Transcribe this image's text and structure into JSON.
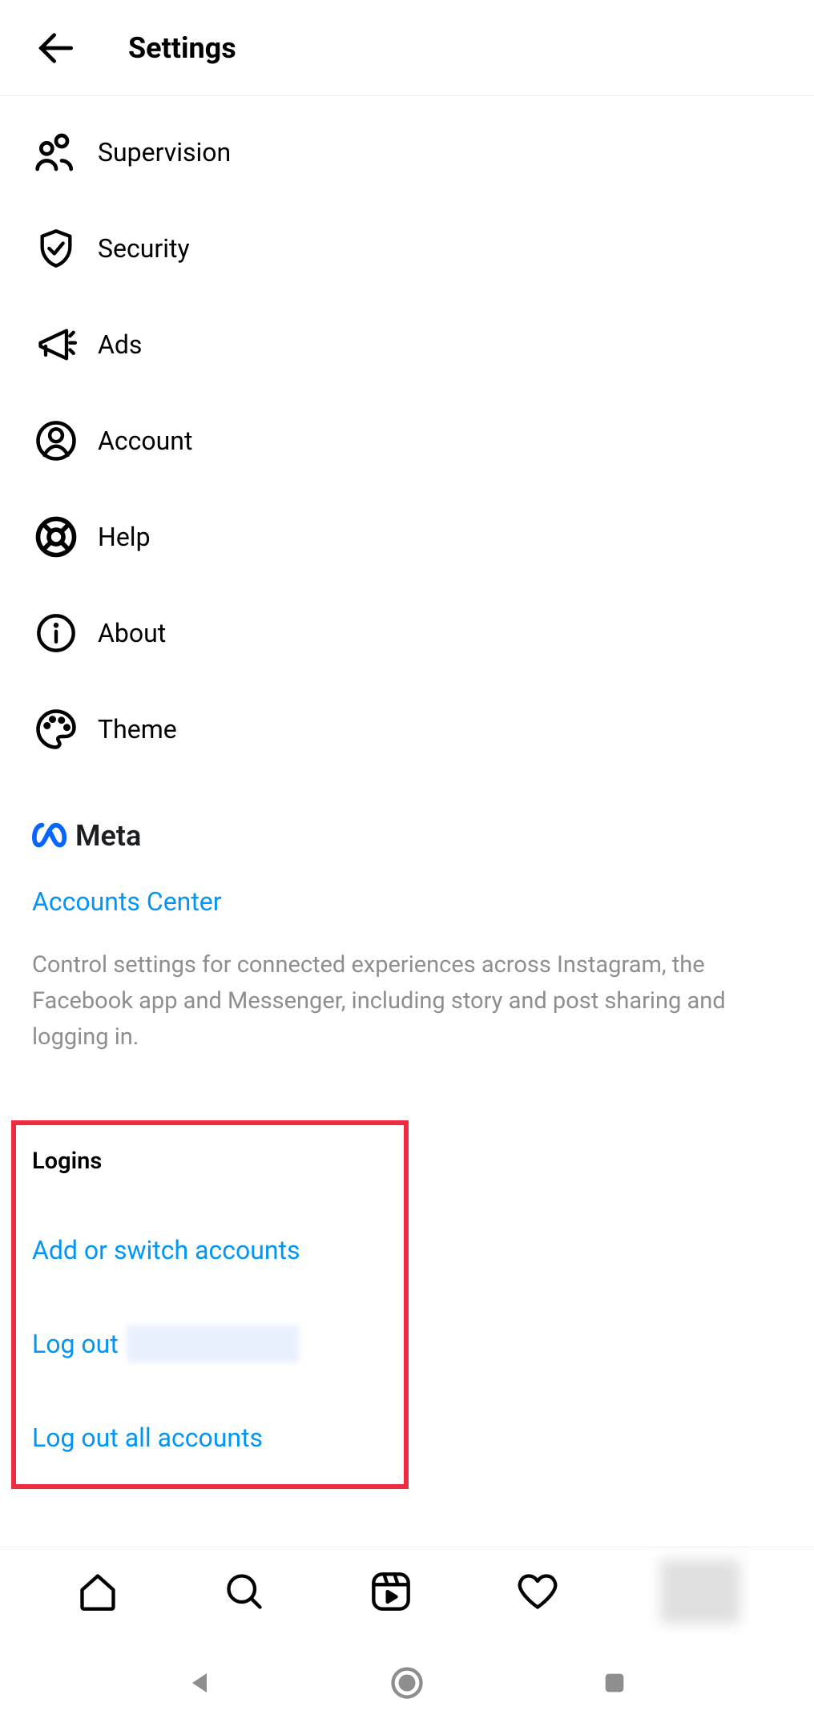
{
  "header": {
    "title": "Settings"
  },
  "settings": {
    "items": [
      {
        "label": "Supervision",
        "icon": "supervision-icon"
      },
      {
        "label": "Security",
        "icon": "security-icon"
      },
      {
        "label": "Ads",
        "icon": "ads-icon"
      },
      {
        "label": "Account",
        "icon": "account-icon"
      },
      {
        "label": "Help",
        "icon": "help-icon"
      },
      {
        "label": "About",
        "icon": "about-icon"
      },
      {
        "label": "Theme",
        "icon": "theme-icon"
      }
    ]
  },
  "meta": {
    "brand": "Meta",
    "accounts_center_label": "Accounts Center",
    "description": "Control settings for connected experiences across Instagram, the Facebook app and Messenger, including story and post sharing and logging in."
  },
  "logins": {
    "title": "Logins",
    "add_switch_label": "Add or switch accounts",
    "logout_label": "Log out",
    "logout_all_label": "Log out all accounts"
  },
  "colors": {
    "link_blue": "#0095f6",
    "highlight_red": "#ef2c3f",
    "gray_text": "#8e8e8e"
  }
}
